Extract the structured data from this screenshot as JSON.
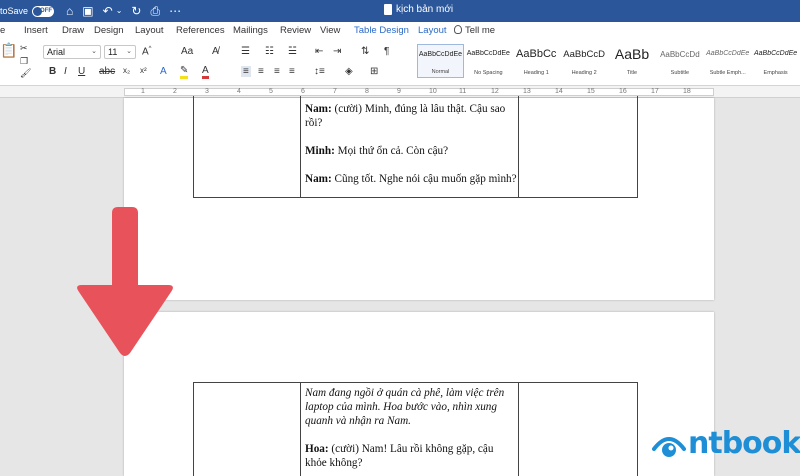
{
  "titlebar": {
    "autosave_label": "toSave",
    "toggle_state": "OFF",
    "doc_title": "kịch bản mới"
  },
  "tabs": [
    "e",
    "Insert",
    "Draw",
    "Design",
    "Layout",
    "References",
    "Mailings",
    "Review",
    "View",
    "Table Design",
    "Layout"
  ],
  "tell_me": "Tell me",
  "ribbon": {
    "font_name": "Arial",
    "font_size": "11",
    "styles": [
      {
        "preview": "AaBbCcDdEe",
        "name": "Normal"
      },
      {
        "preview": "AaBbCcDdEe",
        "name": "No Spacing"
      },
      {
        "preview": "AaBbCc",
        "name": "Heading 1"
      },
      {
        "preview": "AaBbCcD",
        "name": "Heading 2"
      },
      {
        "preview": "AaBb",
        "name": "Title"
      },
      {
        "preview": "AaBbCcDd",
        "name": "Subtitle"
      },
      {
        "preview": "AaBbCcDdEe",
        "name": "Subtle Emph..."
      },
      {
        "preview": "AaBbCcDdEe",
        "name": "Emphasis"
      }
    ]
  },
  "ruler_numbers": [
    "1",
    "2",
    "3",
    "4",
    "5",
    "6",
    "7",
    "8",
    "9",
    "10",
    "11",
    "12",
    "13",
    "14",
    "15",
    "16",
    "17",
    "18"
  ],
  "page1": {
    "lines": [
      {
        "speaker": "Nam:",
        "text": " (cười) Minh, đúng là lâu thật. Cậu sao rồi?"
      },
      {
        "speaker": "Minh:",
        "text": " Mọi thứ ổn cả. Còn cậu?"
      },
      {
        "speaker": "Nam:",
        "text": " Cũng tốt. Nghe nói cậu muốn gặp mình?"
      }
    ]
  },
  "page2": {
    "narration": "Nam đang ngồi ở quán cà phê, làm việc trên laptop của mình. Hoa bước vào, nhìn xung quanh và nhận ra Nam.",
    "lines": [
      {
        "speaker": "Hoa:",
        "text": " (cười) Nam! Lâu rồi không gặp, cậu khỏe không?"
      }
    ]
  },
  "logo_text": "ntbook",
  "colors": {
    "titlebar": "#2b579a",
    "arrow": "#e8525a",
    "logo": "#1e8fd6",
    "accent_tab": "#2b6ac9"
  }
}
